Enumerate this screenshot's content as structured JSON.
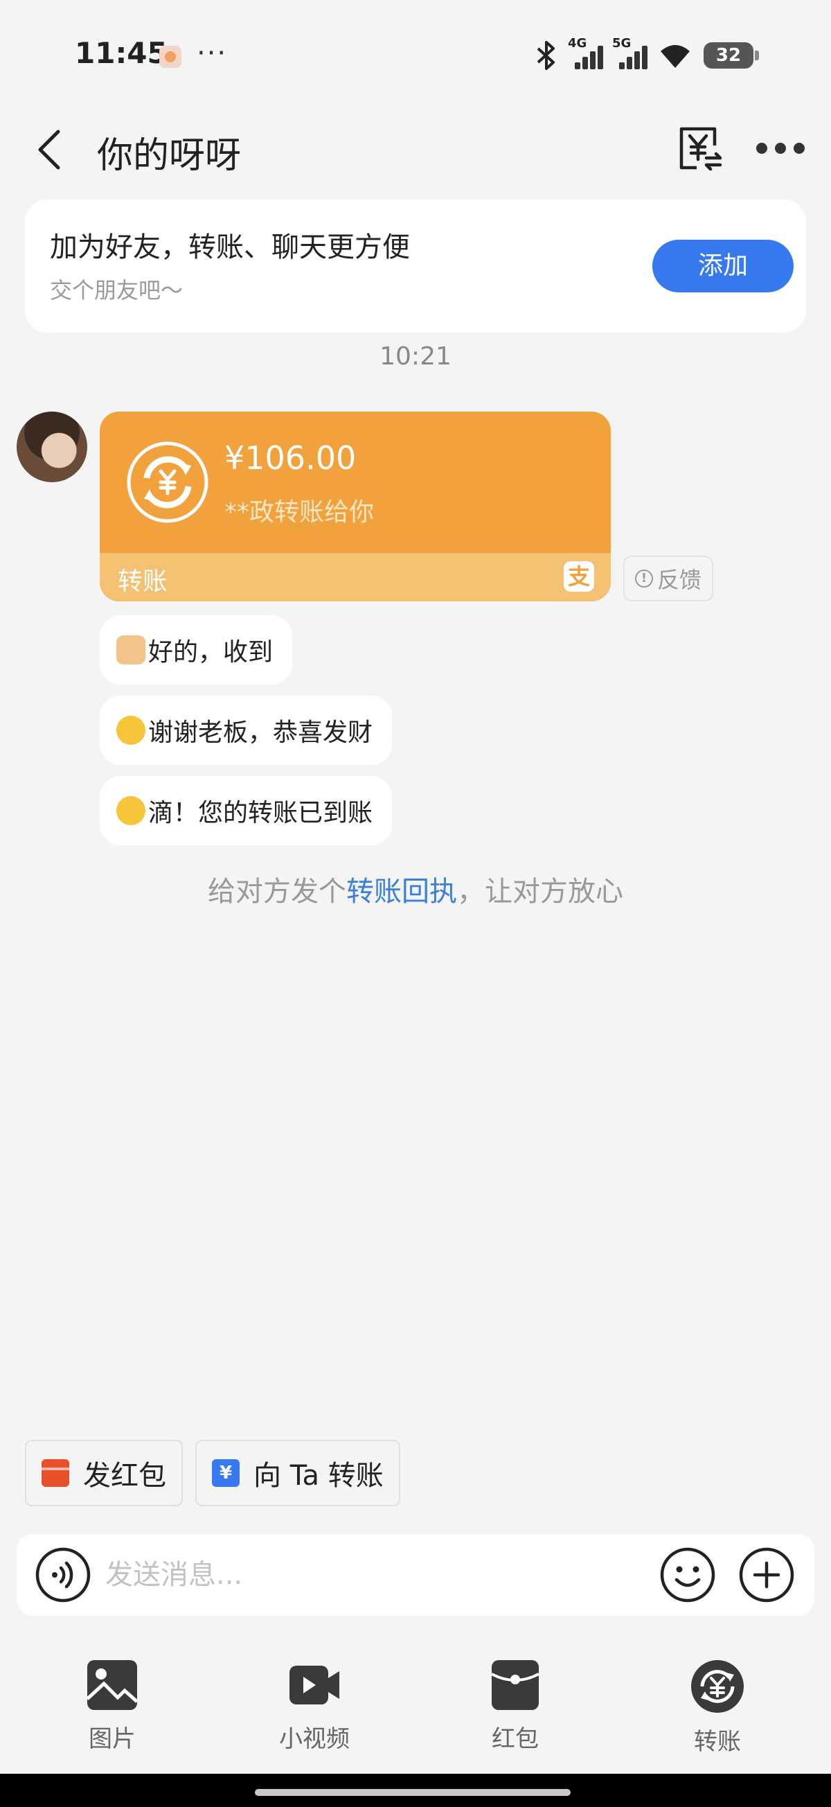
{
  "status_bar": {
    "time": "11:45",
    "dots": "···",
    "signal_4g": "4G",
    "signal_5g": "5G",
    "battery": "32"
  },
  "top_bar": {
    "title": "你的呀呀"
  },
  "friend_card": {
    "title": "加为好友，转账、聊天更方便",
    "subtitle": "交个朋友吧～",
    "button": "添加"
  },
  "time_divider": "10:21",
  "transfer": {
    "amount": "¥106.00",
    "description": "**政转账给你",
    "footer_label": "转账",
    "alipay_glyph": "支",
    "accent_color": "#f2a23c",
    "footer_color": "#f4c071"
  },
  "feedback": {
    "icon": "!",
    "label": "反馈"
  },
  "messages": [
    {
      "emoji": "handshake-emoji",
      "text": "好的，收到"
    },
    {
      "emoji": "smile-hand-emoji",
      "text": "谢谢老板，恭喜发财"
    },
    {
      "emoji": "smirk-emoji",
      "text": "滴！您的转账已到账"
    }
  ],
  "receipt_hint": {
    "prefix": "给对方发个",
    "link": "转账回执",
    "suffix": "，让对方放心"
  },
  "quick_actions": [
    {
      "icon": "red-envelope-icon",
      "label": "发红包"
    },
    {
      "icon": "transfer-card-icon",
      "glyph": "¥",
      "label": "向 Ta 转账"
    }
  ],
  "input_bar": {
    "placeholder": "发送消息..."
  },
  "tools": [
    {
      "icon": "image-icon",
      "label": "图片"
    },
    {
      "icon": "video-icon",
      "label": "小视频"
    },
    {
      "icon": "red-packet-icon",
      "label": "红包"
    },
    {
      "icon": "transfer-icon",
      "label": "转账"
    }
  ],
  "colors": {
    "brand_blue": "#3679f0",
    "link_blue": "#3a7fdc",
    "background": "#f4f4f4"
  }
}
